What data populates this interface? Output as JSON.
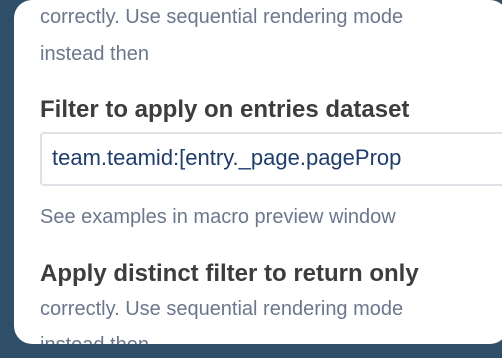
{
  "form": {
    "prev_desc_line1": "correctly. Use sequential rendering mode",
    "prev_desc_line2": "instead then",
    "filter_label": "Filter to apply on entries dataset",
    "filter_value": "team.teamid:[entry._page.pageProp",
    "filter_hint": "See examples in macro preview window",
    "distinct_label": "Apply distinct filter to return only",
    "distinct_desc_line1": "correctly. Use sequential rendering mode",
    "distinct_desc_line2": "instead then"
  }
}
